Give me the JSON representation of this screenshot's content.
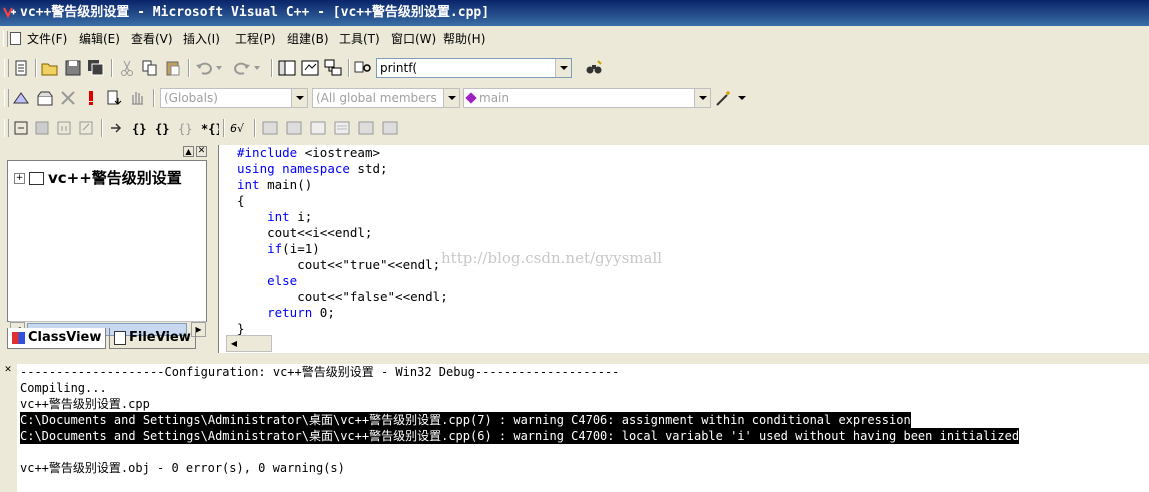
{
  "window": {
    "title": "vc++警告级别设置 - Microsoft Visual C++ - [vc++警告级别设置.cpp]"
  },
  "menu": [
    "文件(F)",
    "编辑(E)",
    "查看(V)",
    "插入(I)",
    "工程(P)",
    "组建(B)",
    "工具(T)",
    "窗口(W)",
    "帮助(H)"
  ],
  "toolbar1": {
    "find_value": "printf("
  },
  "toolbar2": {
    "class_combo": "(Globals)",
    "members_combo": "(All global members",
    "function_combo": "main"
  },
  "workspace": {
    "root_label": "vc++警告级别设置",
    "tabs": [
      "ClassView",
      "FileView"
    ]
  },
  "editor": {
    "lines": [
      "#include <iostream>",
      "using namespace std;",
      "int main()",
      "{",
      "    int i;",
      "    cout<<i<<endl;",
      "    if(i=1)",
      "        cout<<\"true\"<<endl;",
      "    else",
      "        cout<<\"false\"<<endl;",
      "    return 0;",
      "}"
    ],
    "watermark": "http://blog.csdn.net/gyysmall"
  },
  "output": {
    "lines": [
      "--------------------Configuration: vc++警告级别设置 - Win32 Debug--------------------",
      "Compiling...",
      "vc++警告级别设置.cpp",
      "C:\\Documents and Settings\\Administrator\\桌面\\vc++警告级别设置.cpp(7) : warning C4706: assignment within conditional expression",
      "C:\\Documents and Settings\\Administrator\\桌面\\vc++警告级别设置.cpp(6) : warning C4700: local variable 'i' used without having been initialized",
      "",
      "vc++警告级别设置.obj - 0 error(s), 0 warning(s)"
    ]
  }
}
